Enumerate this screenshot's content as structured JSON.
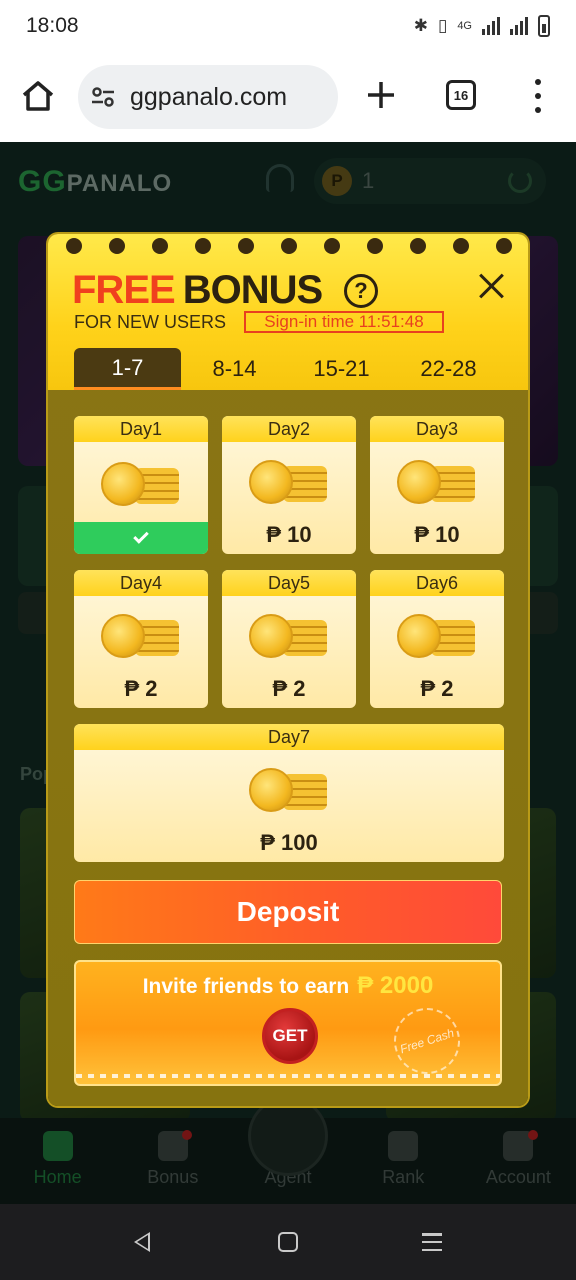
{
  "status_bar": {
    "time": "18:08",
    "network": "4G"
  },
  "browser": {
    "url": "ggpanalo.com",
    "tab_count": "16"
  },
  "site": {
    "logo_gg": "GG",
    "logo_text": "PANALO",
    "balance": "1",
    "currency_symbol": "P",
    "popular_label": "Pop"
  },
  "bottom_nav": [
    {
      "label": "Home"
    },
    {
      "label": "Bonus"
    },
    {
      "label": "Agent"
    },
    {
      "label": "Rank"
    },
    {
      "label": "Account"
    }
  ],
  "modal": {
    "title_free": "FREE",
    "title_bonus": "BONUS",
    "help_symbol": "?",
    "subtitle": "FOR NEW USERS",
    "signin_text": "Sign-in time 11:51:48",
    "tabs": [
      "1-7",
      "8-14",
      "15-21",
      "22-28"
    ],
    "active_tab": "1-7",
    "days": [
      {
        "label": "Day1",
        "amount": "",
        "claimed": true
      },
      {
        "label": "Day2",
        "amount": "₱ 10",
        "claimed": false
      },
      {
        "label": "Day3",
        "amount": "₱ 10",
        "claimed": false
      },
      {
        "label": "Day4",
        "amount": "₱ 2",
        "claimed": false
      },
      {
        "label": "Day5",
        "amount": "₱ 2",
        "claimed": false
      },
      {
        "label": "Day6",
        "amount": "₱ 2",
        "claimed": false
      },
      {
        "label": "Day7",
        "amount": "₱ 100",
        "claimed": false
      }
    ],
    "deposit_label": "Deposit",
    "invite_text": "Invite friends to earn",
    "invite_amount": "₱ 2000",
    "get_label": "GET",
    "stamp_text": "Free Cash"
  },
  "colors": {
    "accent_red": "#f0401e",
    "modal_yellow": "#ffd21a",
    "claimed_green": "#2fcc5c",
    "deposit_orange": "#ff6a24"
  }
}
